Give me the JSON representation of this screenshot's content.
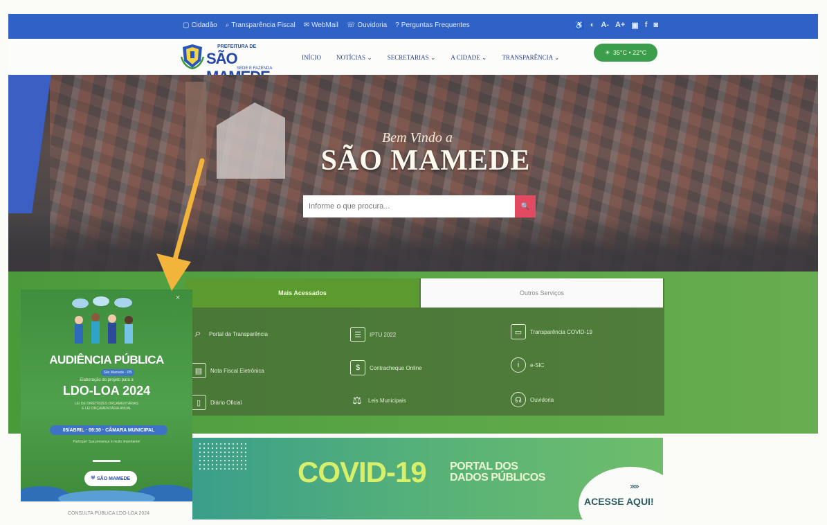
{
  "topbar": {
    "links": [
      {
        "icon": "building-icon",
        "label": "Cidadão"
      },
      {
        "icon": "search-icon",
        "label": "Transparência Fiscal"
      },
      {
        "icon": "mail-icon",
        "label": "WebMail"
      },
      {
        "icon": "ombudsman-icon",
        "label": "Ouvidoria"
      },
      {
        "icon": "help-icon",
        "label": "Perguntas Frequentes"
      }
    ],
    "accessibility": [
      "♿",
      "◐",
      "A-",
      "A+",
      "▣",
      "f",
      "◙"
    ]
  },
  "header": {
    "logo": {
      "small": "PREFEITURA DE",
      "name": "SÃO MAMEDE",
      "tag": "SEDE E FAZENDA"
    },
    "nav": [
      "INÍCIO",
      "NOTÍCIAS ⌄",
      "SECRETARIAS ⌄",
      "A CIDADE ⌄",
      "TRANSPARÊNCIA ⌄"
    ],
    "weather": "35°C • 22°C"
  },
  "hero": {
    "welcome": "Bem Vindo a",
    "title": "SÃO MAMEDE",
    "search_placeholder": "Informe o que procura...",
    "search_button": "🔍"
  },
  "services": {
    "tabs": [
      "Mais Acessados",
      "Outros Serviços"
    ],
    "items": [
      {
        "icon": "magnifier-icon",
        "glyph": "⌕",
        "label": "Portal da Transparência"
      },
      {
        "icon": "document-icon",
        "glyph": "☰",
        "label": "IPTU 2022"
      },
      {
        "icon": "monitor-icon",
        "glyph": "▭",
        "label": "Transparência COVID-19"
      },
      {
        "icon": "invoice-icon",
        "glyph": "▤",
        "label": "Nota Fiscal Eletrônica"
      },
      {
        "icon": "payslip-icon",
        "glyph": "$",
        "label": "Contracheque Online"
      },
      {
        "icon": "info-icon",
        "glyph": "i",
        "label": "e-SIC"
      },
      {
        "icon": "book-icon",
        "glyph": "▯",
        "label": "Diário Oficial"
      },
      {
        "icon": "gavel-icon",
        "glyph": "⚖",
        "label": "Leis Municipais"
      },
      {
        "icon": "headset-icon",
        "glyph": "☊",
        "label": "Ouvidoria"
      }
    ]
  },
  "popup": {
    "close": "×",
    "heading": "AUDIÊNCIA PÚBLICA",
    "small_pill": "São Mamede - PB",
    "elab": "Elaboração do projeto para a",
    "ldo": "LDO-LOA 2024",
    "fine_line1": "LEI DE DIRETRIZES ORÇAMENTÁRIAS",
    "fine_line2": "E LEI ORÇAMENTÁRIA ANUAL",
    "date_bar": "05/ABRIL · 09:30 · CÂMARA MUNICIPAL",
    "participate": "Participe! Sua presença é muito importante!",
    "logo_text": "SÃO MAMEDE",
    "caption": "CONSULTA PÚBLICA LDO-LOA 2024"
  },
  "covid": {
    "big": "COVID-19",
    "portal_line1": "PORTAL DOS",
    "portal_line2": "DADOS PÚBLICOS",
    "chevrons": "›››››",
    "cta": "ACESSE AQUI!"
  },
  "colors": {
    "topbar": "#2f62c4",
    "brand_green": "#5a9a2e",
    "search_button": "#e24a62",
    "arrow": "#f2b43a"
  }
}
